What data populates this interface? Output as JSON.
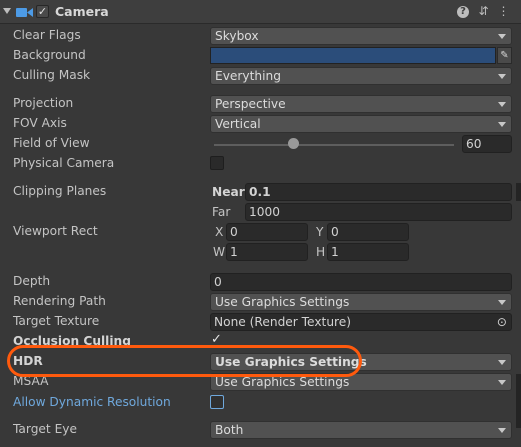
{
  "component": {
    "title": "Camera",
    "enabled_check": "✓",
    "icons": {
      "camera": "camera-icon",
      "help": "?",
      "presets": "⇵",
      "menu": "⋮"
    }
  },
  "properties": {
    "clear_flags": {
      "label": "Clear Flags",
      "value": "Skybox"
    },
    "background": {
      "label": "Background",
      "color": "#2b4d7a",
      "picker_glyph": "✎"
    },
    "culling_mask": {
      "label": "Culling Mask",
      "value": "Everything"
    },
    "projection": {
      "label": "Projection",
      "value": "Perspective"
    },
    "fov_axis": {
      "label": "FOV Axis",
      "value": "Vertical"
    },
    "field_of_view": {
      "label": "Field of View",
      "value": "60",
      "slider_fraction": 0.33
    },
    "physical_camera": {
      "label": "Physical Camera",
      "checked": false
    },
    "clipping_planes": {
      "label": "Clipping Planes",
      "near_label": "Near",
      "near_value": "0.1",
      "far_label": "Far",
      "far_value": "1000"
    },
    "viewport_rect": {
      "label": "Viewport Rect",
      "x_label": "X",
      "x_value": "0",
      "y_label": "Y",
      "y_value": "0",
      "w_label": "W",
      "w_value": "1",
      "h_label": "H",
      "h_value": "1"
    },
    "depth": {
      "label": "Depth",
      "value": "0"
    },
    "rendering_path": {
      "label": "Rendering Path",
      "value": "Use Graphics Settings"
    },
    "target_texture": {
      "label": "Target Texture",
      "value": "None (Render Texture)",
      "picker_glyph": "⊙"
    },
    "occlusion_culling": {
      "label": "Occlusion Culling",
      "check": "✓"
    },
    "hdr": {
      "label": "HDR",
      "value": "Use Graphics Settings"
    },
    "msaa": {
      "label": "MSAA",
      "value": "Use Graphics Settings"
    },
    "allow_dynamic_resolution": {
      "label": "Allow Dynamic Resolution",
      "checked": false
    },
    "target_eye": {
      "label": "Target Eye",
      "value": "Both"
    }
  },
  "annotation": {
    "color": "#ff5a0d"
  }
}
